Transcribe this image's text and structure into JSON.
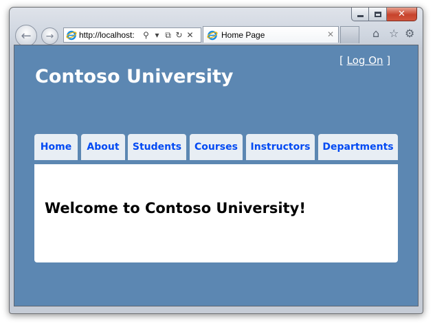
{
  "browser": {
    "address": "http://localhost:",
    "tab_title": "Home Page",
    "tab_close_glyph": "✕",
    "icons": [
      "back-arrow-icon",
      "forward-arrow-icon",
      "ie-icon",
      "search-icon",
      "dropdown-icon",
      "compatibility-icon",
      "refresh-icon",
      "stop-icon",
      "home-icon",
      "favorites-star-icon",
      "tools-gear-icon"
    ]
  },
  "page": {
    "login": {
      "open_bracket": "[",
      "label": "Log On",
      "close_bracket": "]"
    },
    "site_title": "Contoso University",
    "menu": [
      {
        "label": "Home"
      },
      {
        "label": "About"
      },
      {
        "label": "Students"
      },
      {
        "label": "Courses"
      },
      {
        "label": "Instructors"
      },
      {
        "label": "Departments"
      }
    ],
    "welcome": "Welcome to Contoso University!"
  },
  "colors": {
    "page_background": "#5c87b2",
    "menu_tab_background": "#e8eef4",
    "menu_link": "#034af3"
  }
}
